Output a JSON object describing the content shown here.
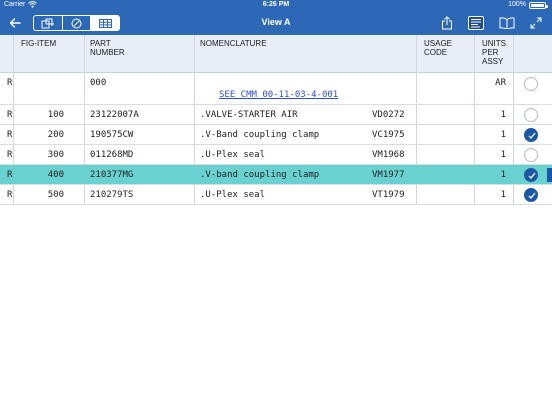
{
  "status": {
    "carrier": "Carrier",
    "time": "6:26 PM",
    "battery": "100%"
  },
  "nav": {
    "title": "View A",
    "segments": [
      "parts-icon",
      "no-entry-icon",
      "grid-icon"
    ],
    "active_segment": 2
  },
  "table": {
    "headers": {
      "fig_item": "FIG-ITEM",
      "part_number_1": "PART",
      "part_number_2": "NUMBER",
      "nomenclature": "NOMENCLATURE",
      "usage_code_1": "USAGE",
      "usage_code_2": "CODE",
      "units_1": "UNITS",
      "units_2": "PER",
      "units_3": "ASSY"
    },
    "rows": [
      {
        "flag": "R",
        "fig": "",
        "part": "000",
        "nom": "",
        "vendor": "",
        "units": "AR",
        "checked": false,
        "selected": false
      },
      {
        "flag": "R",
        "fig": "100",
        "part": "23122007A",
        "nom": ".VALVE-STARTER AIR",
        "vendor": "VD0272",
        "units": "1",
        "checked": false,
        "selected": false
      },
      {
        "flag": "R",
        "fig": "200",
        "part": "190575CW",
        "nom": ".V-Band coupling clamp",
        "vendor": "VC1975",
        "units": "1",
        "checked": true,
        "selected": false
      },
      {
        "flag": "R",
        "fig": "300",
        "part": "011268MD",
        "nom": ".U-Plex seal",
        "vendor": "VM1968",
        "units": "1",
        "checked": false,
        "selected": false
      },
      {
        "flag": "R",
        "fig": "400",
        "part": "210377MG",
        "nom": ".V-band coupling clamp",
        "vendor": "VM1977",
        "units": "1",
        "checked": true,
        "selected": true
      },
      {
        "flag": "R",
        "fig": "500",
        "part": "210279TS",
        "nom": ".U-Plex seal",
        "vendor": "VT1979",
        "units": "1",
        "checked": true,
        "selected": false
      }
    ],
    "cmm_link": "SEE CMM 00-11-03-4-001"
  },
  "colors": {
    "bar": "#2d68b6",
    "selected_row": "#6ad1d1",
    "check_on": "#1c57a7"
  }
}
